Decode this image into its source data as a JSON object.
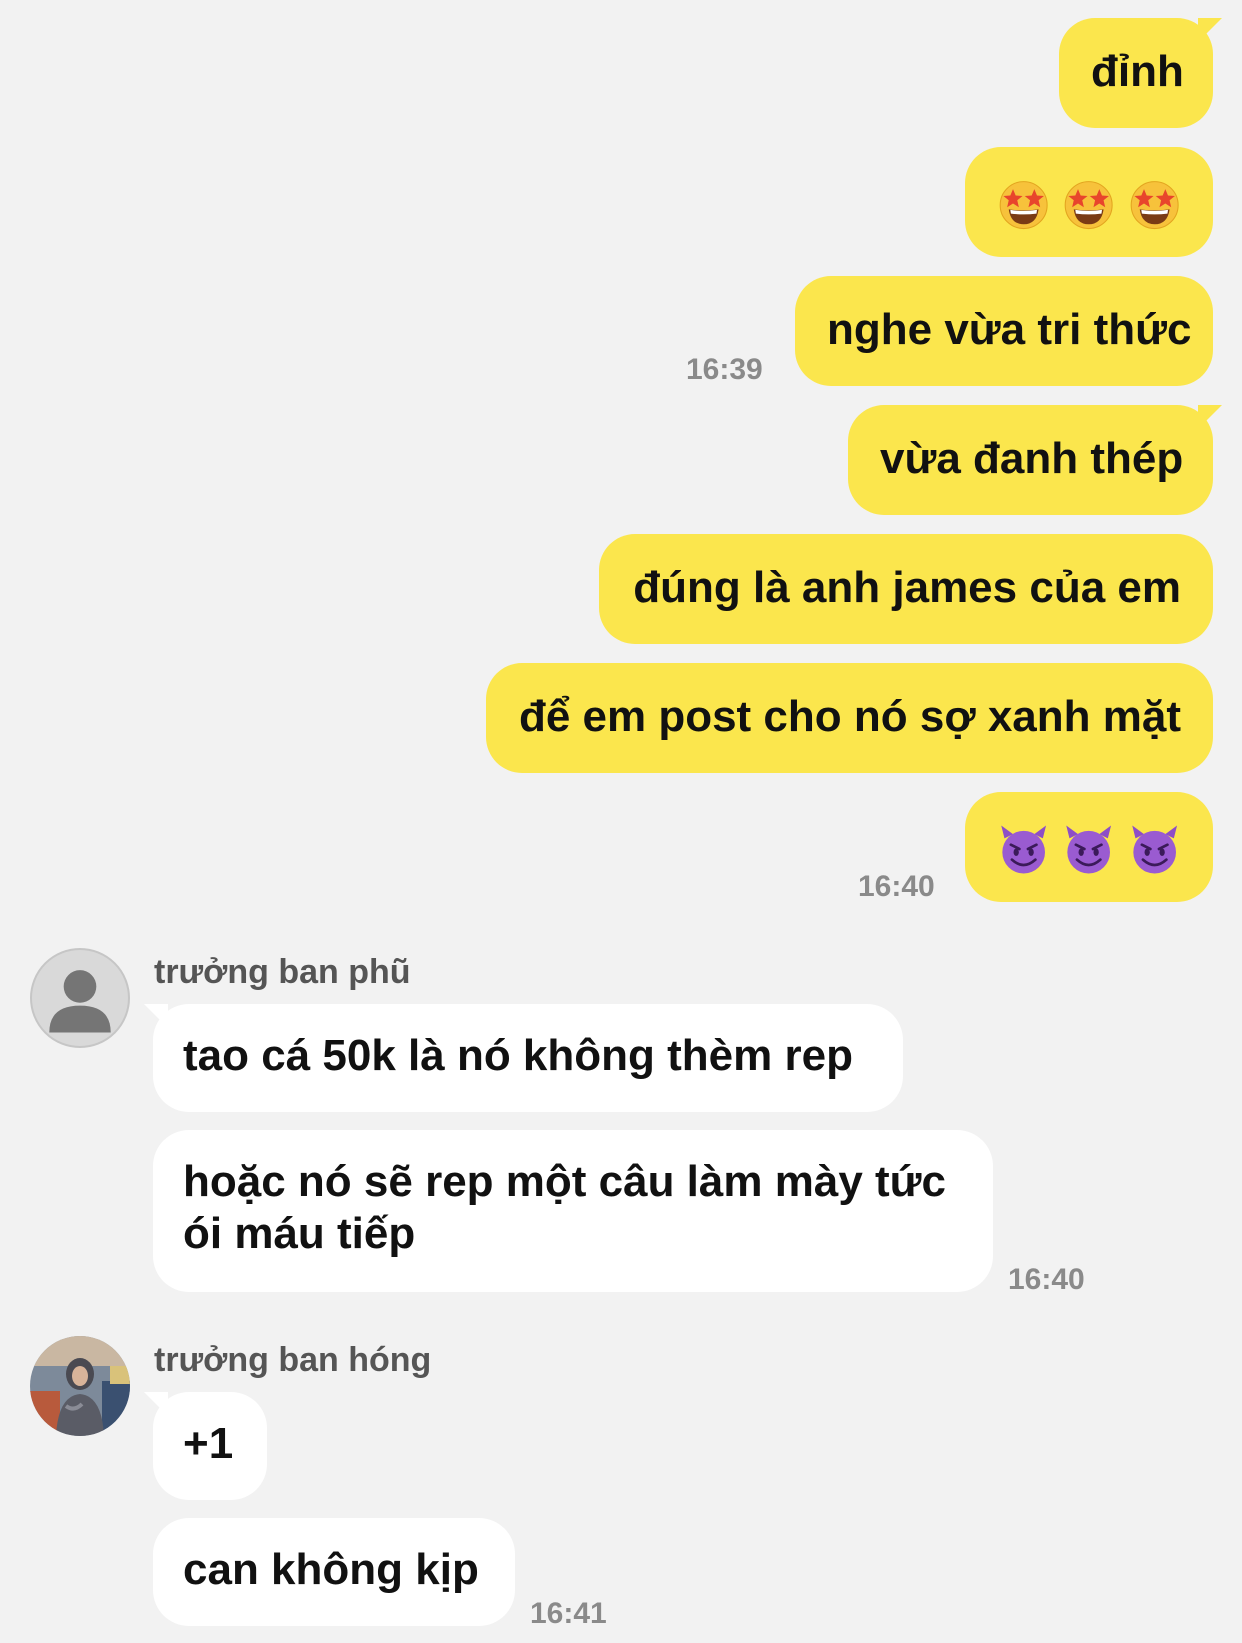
{
  "outgoing": [
    {
      "text": "đỉnh"
    },
    {
      "emoji": [
        "star-struck-emoji",
        "star-struck-emoji",
        "star-struck-emoji"
      ]
    },
    {
      "text": "nghe vừa tri thức",
      "time": "16:39"
    },
    {
      "text": "vừa đanh thép"
    },
    {
      "text": "đúng là anh james của em"
    },
    {
      "text": "để em post cho nó sợ xanh mặt"
    },
    {
      "emoji": [
        "smiling-devil-emoji",
        "smiling-devil-emoji",
        "smiling-devil-emoji"
      ],
      "time": "16:40"
    }
  ],
  "incoming": [
    {
      "sender": "trưởng ban phũ",
      "avatar": "default-avatar",
      "messages": [
        {
          "text": "tao cá 50k là nó không thèm rep"
        },
        {
          "text_lines": [
            "hoặc nó sẽ rep một câu làm mày tức",
            "ói máu tiếp"
          ],
          "time": "16:40"
        }
      ]
    },
    {
      "sender": "trưởng ban hóng",
      "avatar": "photo-avatar",
      "messages": [
        {
          "text": "+1"
        },
        {
          "text": "can không kịp",
          "time": "16:41"
        }
      ]
    }
  ],
  "colors": {
    "background": "#f2f2f2",
    "outgoing_bubble": "#fbe64d",
    "incoming_bubble": "#ffffff",
    "timestamp": "#8a8a8a"
  }
}
